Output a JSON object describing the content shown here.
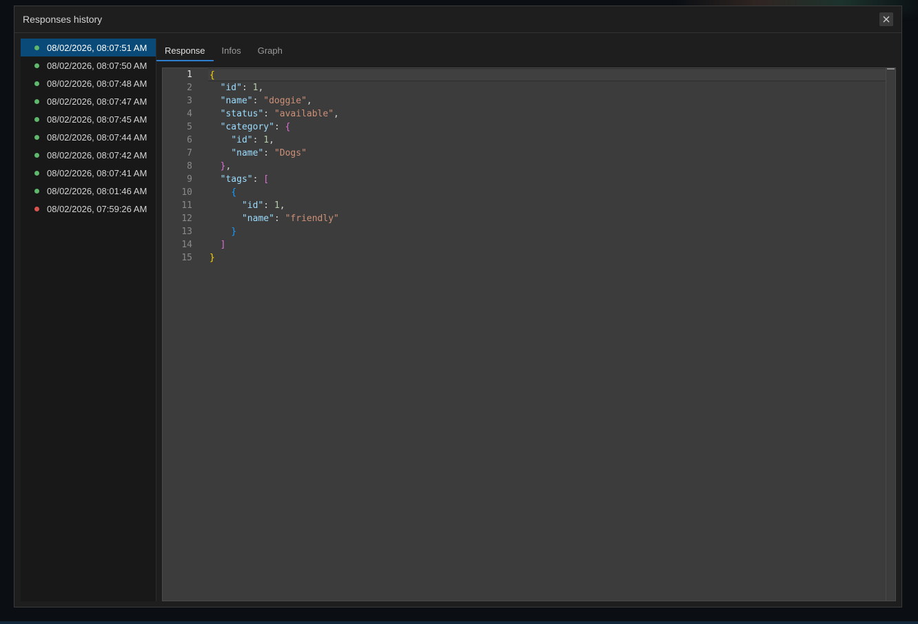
{
  "dialog": {
    "title": "Responses history"
  },
  "colors": {
    "success": "#5fb86b",
    "error": "#d9534f",
    "selected_bg": "#0a4a78",
    "accent": "#2f7fd0"
  },
  "history": [
    {
      "timestamp": "08/02/2026, 08:07:51 AM",
      "status": "success",
      "selected": true
    },
    {
      "timestamp": "08/02/2026, 08:07:50 AM",
      "status": "success"
    },
    {
      "timestamp": "08/02/2026, 08:07:48 AM",
      "status": "success"
    },
    {
      "timestamp": "08/02/2026, 08:07:47 AM",
      "status": "success"
    },
    {
      "timestamp": "08/02/2026, 08:07:45 AM",
      "status": "success"
    },
    {
      "timestamp": "08/02/2026, 08:07:44 AM",
      "status": "success"
    },
    {
      "timestamp": "08/02/2026, 08:07:42 AM",
      "status": "success"
    },
    {
      "timestamp": "08/02/2026, 08:07:41 AM",
      "status": "success"
    },
    {
      "timestamp": "08/02/2026, 08:01:46 AM",
      "status": "success"
    },
    {
      "timestamp": "08/02/2026, 07:59:26 AM",
      "status": "error"
    }
  ],
  "tabs": [
    {
      "label": "Response",
      "active": true
    },
    {
      "label": "Infos"
    },
    {
      "label": "Graph"
    }
  ],
  "editor": {
    "current_line": 1,
    "lines": [
      [
        [
          "b1",
          "{"
        ]
      ],
      [
        [
          "p",
          "  "
        ],
        [
          "k",
          "\"id\""
        ],
        [
          "p",
          ": "
        ],
        [
          "n",
          "1"
        ],
        [
          "p",
          ","
        ]
      ],
      [
        [
          "p",
          "  "
        ],
        [
          "k",
          "\"name\""
        ],
        [
          "p",
          ": "
        ],
        [
          "s",
          "\"doggie\""
        ],
        [
          "p",
          ","
        ]
      ],
      [
        [
          "p",
          "  "
        ],
        [
          "k",
          "\"status\""
        ],
        [
          "p",
          ": "
        ],
        [
          "s",
          "\"available\""
        ],
        [
          "p",
          ","
        ]
      ],
      [
        [
          "p",
          "  "
        ],
        [
          "k",
          "\"category\""
        ],
        [
          "p",
          ": "
        ],
        [
          "b2",
          "{"
        ]
      ],
      [
        [
          "p",
          "    "
        ],
        [
          "k",
          "\"id\""
        ],
        [
          "p",
          ": "
        ],
        [
          "n",
          "1"
        ],
        [
          "p",
          ","
        ]
      ],
      [
        [
          "p",
          "    "
        ],
        [
          "k",
          "\"name\""
        ],
        [
          "p",
          ": "
        ],
        [
          "s",
          "\"Dogs\""
        ]
      ],
      [
        [
          "p",
          "  "
        ],
        [
          "b2",
          "}"
        ],
        [
          "p",
          ","
        ]
      ],
      [
        [
          "p",
          "  "
        ],
        [
          "k",
          "\"tags\""
        ],
        [
          "p",
          ": "
        ],
        [
          "b2",
          "["
        ]
      ],
      [
        [
          "p",
          "    "
        ],
        [
          "b3",
          "{"
        ]
      ],
      [
        [
          "p",
          "      "
        ],
        [
          "k",
          "\"id\""
        ],
        [
          "p",
          ": "
        ],
        [
          "n",
          "1"
        ],
        [
          "p",
          ","
        ]
      ],
      [
        [
          "p",
          "      "
        ],
        [
          "k",
          "\"name\""
        ],
        [
          "p",
          ": "
        ],
        [
          "s",
          "\"friendly\""
        ]
      ],
      [
        [
          "p",
          "    "
        ],
        [
          "b3",
          "}"
        ]
      ],
      [
        [
          "p",
          "  "
        ],
        [
          "b2",
          "]"
        ]
      ],
      [
        [
          "b1",
          "}"
        ]
      ]
    ]
  }
}
